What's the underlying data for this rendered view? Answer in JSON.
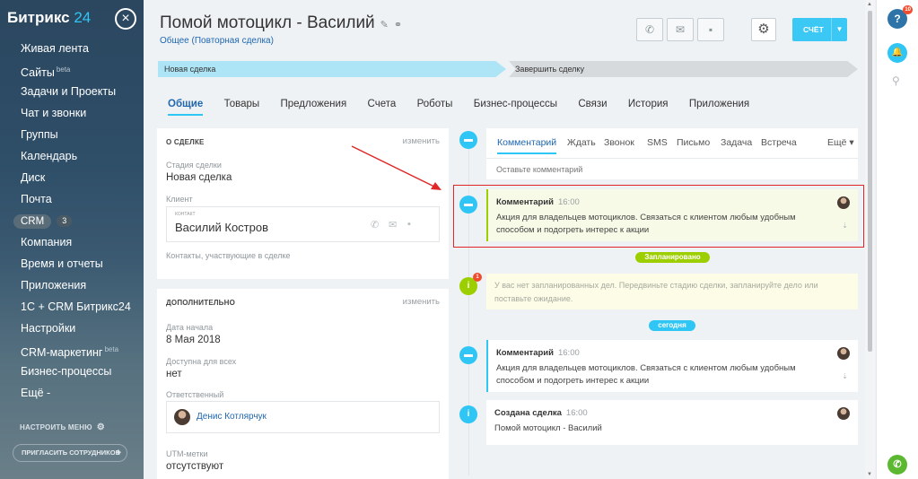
{
  "sidebar": {
    "logo": "Битрикс",
    "logo_num": "24",
    "close": "×",
    "items": [
      "Живая лента",
      "Сайты",
      "Задачи и Проекты",
      "Чат и звонки",
      "Группы",
      "Календарь",
      "Диск",
      "Почта",
      "CRM",
      "Компания",
      "Время и отчеты",
      "Приложения",
      "1С + CRM Битрикс24",
      "Настройки",
      "CRM-маркетинг",
      "Бизнес-процессы",
      "Ещё -"
    ],
    "sites_sup": "beta",
    "crm_count": "3",
    "marketing_sup": "beta",
    "setup_menu": "НАСТРОИТЬ МЕНЮ",
    "invite": "ПРИГЛАСИТЬ СОТРУДНИКОВ"
  },
  "header": {
    "title": "Помой мотоцикл - Василий",
    "subtitle": "Общее (Повторная сделка)",
    "schet": "СЧЁТ"
  },
  "stages": [
    "Новая сделка",
    "Завершить сделку"
  ],
  "tabs": [
    "Общие",
    "Товары",
    "Предложения",
    "Счета",
    "Роботы",
    "Бизнес-процессы",
    "Связи",
    "История",
    "Приложения"
  ],
  "about": {
    "head": "О СДЕЛКЕ",
    "edit": "изменить",
    "stage_label": "Стадия сделки",
    "stage_value": "Новая сделка",
    "client_label": "Клиент",
    "contact_caption": "КОНТАКТ",
    "client_name": "Василий Костров",
    "contacts_label": "Контакты, участвующие в сделке"
  },
  "extra": {
    "head": "ДОПОЛНИТЕЛЬНО",
    "edit": "изменить",
    "date_label": "Дата начала",
    "date_value": "8 Мая 2018",
    "access_label": "Доступна для всех",
    "access_value": "нет",
    "resp_label": "Ответственный",
    "resp_name": "Денис Котлярчук",
    "utm_label": "UTM-метки",
    "utm_value": "отсутствуют"
  },
  "compose": {
    "tabs": [
      "Комментарий",
      "Ждать",
      "Звонок",
      "SMS",
      "Письмо",
      "Задача",
      "Встреча",
      "Ещё ▾"
    ],
    "placeholder": "Оставьте комментарий"
  },
  "timeline": {
    "comment1": {
      "title": "Комментарий",
      "time": "16:00",
      "text": "Акция для владельцев мотоциклов. Связаться с клиентом любым удобным способом и подогреть интерес к акции"
    },
    "planned_pill": "Запланировано",
    "planned_badge": "1",
    "planned_text": "У вас нет запланированных дел. Передвиньте стадию сделки, запланируйте дело или поставьте ожидание.",
    "today_pill": "сегодня",
    "comment2": {
      "title": "Комментарий",
      "time": "16:00",
      "text": "Акция для владельцев мотоциклов. Связаться с клиентом любым удобным способом и подогреть интерес к акции"
    },
    "created": {
      "title": "Создана сделка",
      "time": "16:00",
      "text": "Помой мотоцикл - Василий"
    }
  },
  "rail": {
    "help_count": "10"
  },
  "icons": [
    "close-icon",
    "phone-icon",
    "mail-icon",
    "chat-icon",
    "gear-icon",
    "chevron-down-icon",
    "comment-icon",
    "info-icon",
    "pin-icon",
    "bell-icon",
    "search-icon",
    "question-icon"
  ]
}
